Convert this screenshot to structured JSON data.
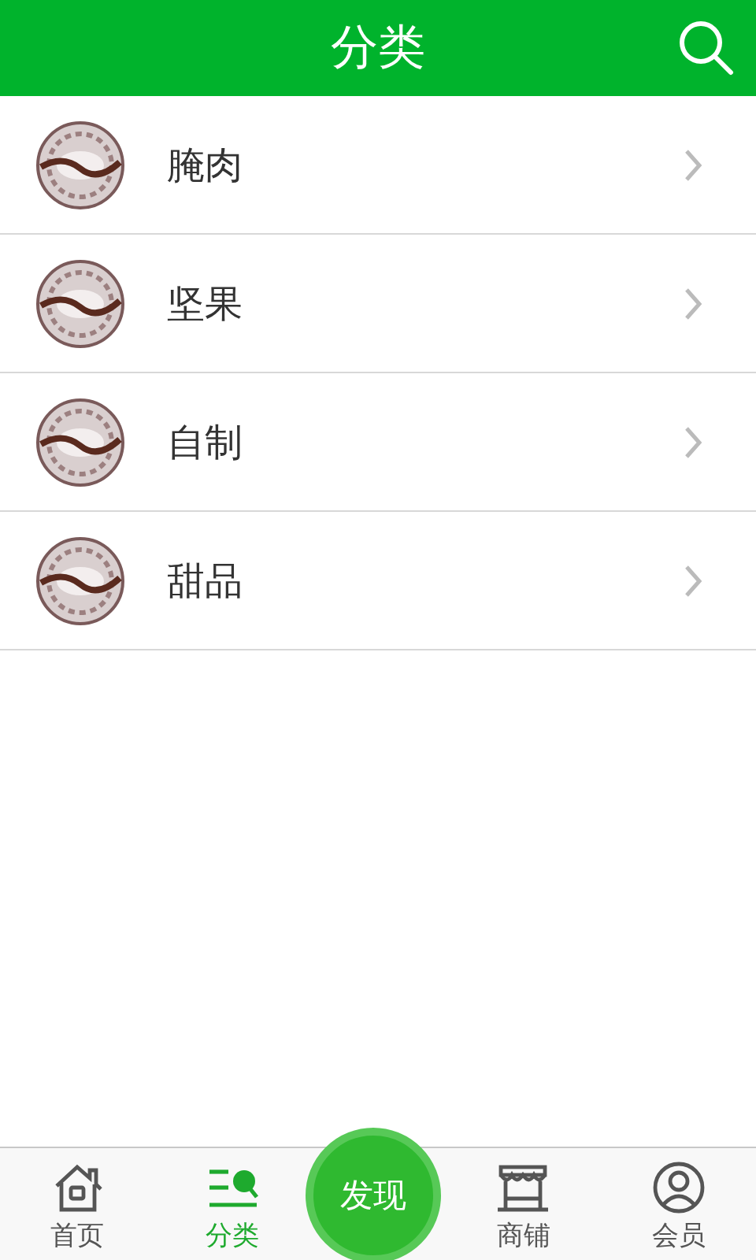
{
  "header": {
    "title": "分类"
  },
  "categories": [
    {
      "name": "腌肉"
    },
    {
      "name": "坚果"
    },
    {
      "name": "自制"
    },
    {
      "name": "甜品"
    }
  ],
  "tabs": [
    {
      "label": "首页",
      "kind": "home",
      "selected": false
    },
    {
      "label": "分类",
      "kind": "category",
      "selected": true
    },
    {
      "label": "发现",
      "kind": "center",
      "selected": false
    },
    {
      "label": "商铺",
      "kind": "shop",
      "selected": false
    },
    {
      "label": "会员",
      "kind": "member",
      "selected": false
    }
  ]
}
